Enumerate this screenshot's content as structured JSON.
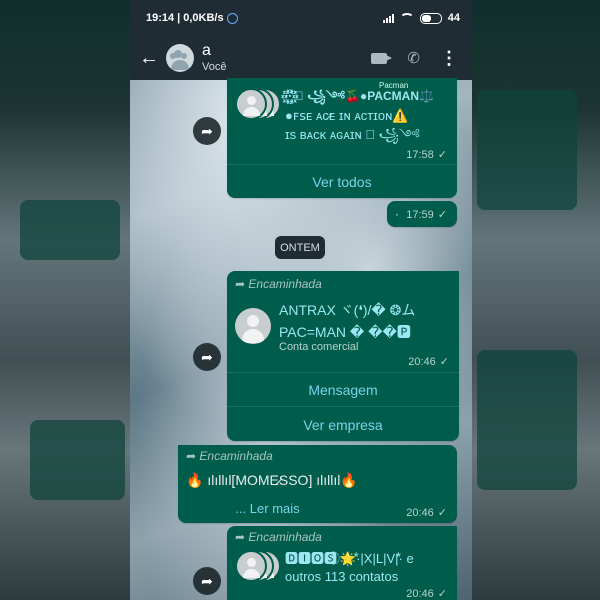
{
  "status": {
    "time": "19:14",
    "speed": "0,0KB/s",
    "battery": "44"
  },
  "chat": {
    "title": "a",
    "subtitle": "Você"
  },
  "messages": [
    {
      "lines": [
        "·꙰꙰·꙰꙰ ⃝ ꧁༺🍒●PACMAN⚖️",
        "●ꜰꜱᴇ ᴀᴄ̷ᴇ ɪɴ ᴀᴄᴛɪᴏɴ⚠️",
        "ɪs ʙᴀᴄᴋ ᴀɢᴀɪɴ ⃝ ꧁༺"
      ],
      "overline": "Pacman",
      "time": "17:58",
      "action": "Ver todos"
    },
    {
      "text": "·",
      "time": "17:59"
    }
  ],
  "date_chip": "ONTEM",
  "business": {
    "forwarded": "Encaminhada",
    "name_line1": "ANTRAX ヾ(❛)/� ❂ム",
    "name_line2": "PAC=MAN � ��🅿",
    "label": "Conta comercial",
    "time": "20:46",
    "actions": [
      "Mensagem",
      "Ver empresa"
    ]
  },
  "forward_text": {
    "forwarded": "Encaminhada",
    "text": "🔥 ılıllıl[MOME̷SSO] ılıllıl🔥",
    "more": "... Ler mais",
    "time": "20:46"
  },
  "contacts": {
    "forwarded": "Encaminhada",
    "line1": "🅳🅸🅾🆂 ⃝🌟⃰·|X|L|V|⃰· e",
    "line2": "outros 113 contatos",
    "time": "20:46"
  }
}
